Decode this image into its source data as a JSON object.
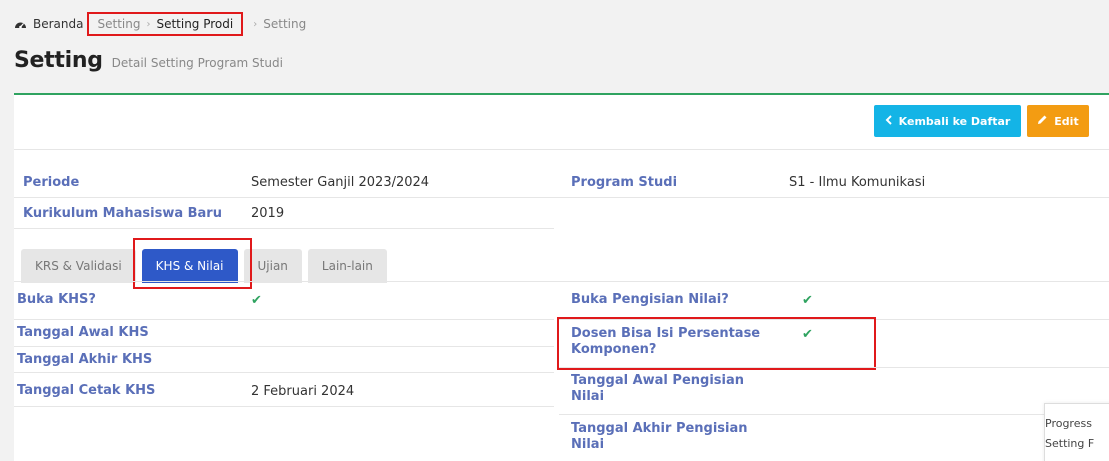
{
  "breadcrumb": {
    "home": "Beranda",
    "setting": "Setting",
    "setting_prodi": "Setting Prodi",
    "current": "Setting"
  },
  "header": {
    "title": "Setting",
    "subtitle": "Detail Setting Program Studi"
  },
  "toolbar": {
    "back_label": "Kembali ke Daftar",
    "edit_label": "Edit"
  },
  "info": {
    "periode_label": "Periode",
    "periode_value": "Semester Ganjil 2023/2024",
    "program_studi_label": "Program Studi",
    "program_studi_value": "S1 - Ilmu Komunikasi",
    "kurikulum_label": "Kurikulum Mahasiswa Baru",
    "kurikulum_value": "2019"
  },
  "tabs": [
    "KRS & Validasi",
    "KHS & Nilai",
    "Ujian",
    "Lain-lain"
  ],
  "active_tab": "KHS & Nilai",
  "khs": {
    "buka_khs_label": "Buka KHS?",
    "buka_khs_value": "✔",
    "tgl_awal_khs_label": "Tanggal Awal KHS",
    "tgl_akhir_khs_label": "Tanggal Akhir KHS",
    "tgl_cetak_khs_label": "Tanggal Cetak KHS",
    "tgl_cetak_khs_value": "2 Februari 2024"
  },
  "nilai": {
    "buka_pengisian_label": "Buka Pengisian Nilai?",
    "buka_pengisian_value": "✔",
    "dosen_persentase_label_1": "Dosen Bisa Isi Persentase",
    "dosen_persentase_label_2": "Komponen?",
    "dosen_persentase_value": "✔",
    "tgl_awal_pengisian_label_1": "Tanggal Awal Pengisian",
    "tgl_awal_pengisian_label_2": "Nilai",
    "tgl_akhir_pengisian_label_1": "Tanggal Akhir Pengisian",
    "tgl_akhir_pengisian_label_2": "Nilai"
  },
  "progress_panel": {
    "line1": "Progress",
    "line2": "Setting F"
  },
  "colors": {
    "label": "#5a6fb8",
    "back_button": "#14b4e6",
    "edit_button": "#f39c12",
    "active_tab": "#2e59c8",
    "check": "#2fa360",
    "highlight": "#e0191b"
  },
  "icons": {
    "home": "dashboard-icon",
    "back": "chevron-left-icon",
    "edit": "pencil-icon",
    "check": "check-icon"
  }
}
